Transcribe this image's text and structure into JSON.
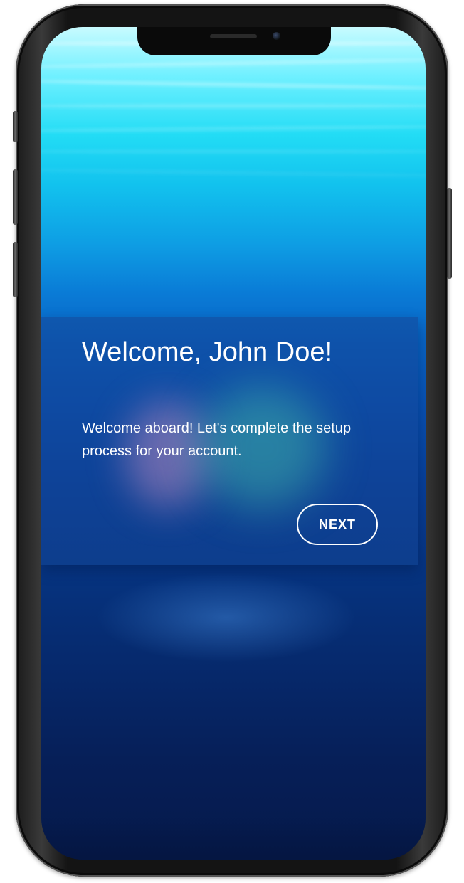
{
  "card": {
    "title": "Welcome, John Doe!",
    "message": "Welcome aboard! Let's complete the setup process for your account.",
    "next_label": "NEXT"
  },
  "colors": {
    "card_background": "#1e5aa8",
    "text": "#ffffff",
    "water_top": "#6ef0ff",
    "water_bottom": "#05194a"
  }
}
